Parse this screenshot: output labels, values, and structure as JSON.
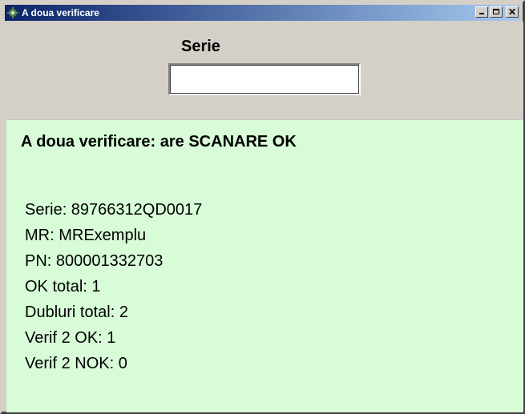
{
  "window": {
    "title": "A doua verificare",
    "icon": "app-gear-icon",
    "controls": {
      "minimize": "minimize-icon",
      "maximize": "maximize-icon",
      "close_label": "✕"
    }
  },
  "form": {
    "serie_label": "Serie",
    "serie_value": "",
    "serie_placeholder": ""
  },
  "result": {
    "status_title": "A doua verificare: are SCANARE OK",
    "background_color": "#d8fcd8",
    "lines": [
      "Serie: 89766312QD0017",
      "MR: MRExemplu",
      "PN: 800001332703",
      "OK total: 1",
      "Dubluri total: 2",
      "Verif 2 OK: 1",
      "Verif 2 NOK: 0"
    ]
  }
}
